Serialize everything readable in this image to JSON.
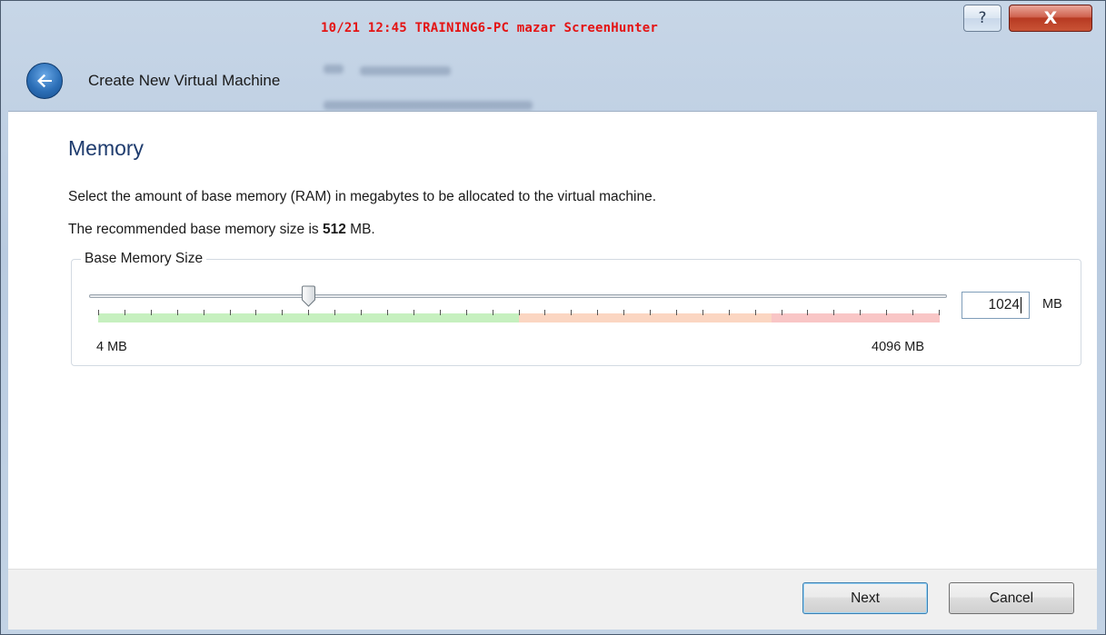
{
  "titlebar": {
    "overlay_caption": "10/21 12:45 TRAINING6-PC mazar ScreenHunter",
    "help_glyph": "?",
    "close_glyph": "X"
  },
  "header": {
    "back_icon": "back-arrow-icon",
    "title": "Create New Virtual Machine"
  },
  "page": {
    "title": "Memory",
    "description": "Select the amount of base memory (RAM) in megabytes to be allocated to the virtual machine.",
    "recommend_prefix": "The recommended base memory size is",
    "recommend_value": "512",
    "recommend_unit": "MB."
  },
  "memory": {
    "group_label": "Base Memory Size",
    "min_label": "4 MB",
    "max_label": "4096 MB",
    "min_mb": 4,
    "max_mb": 4096,
    "value_mb": 1024,
    "value_text": "1024",
    "unit": "MB",
    "zones": [
      {
        "name": "green",
        "fraction": 0.5,
        "color": "#c6f0bf"
      },
      {
        "name": "orange",
        "fraction": 0.3,
        "color": "#fbd6c2"
      },
      {
        "name": "red",
        "fraction": 0.2,
        "color": "#f9c6c6"
      }
    ],
    "tick_count": 32
  },
  "footer": {
    "next_label": "Next",
    "cancel_label": "Cancel"
  }
}
